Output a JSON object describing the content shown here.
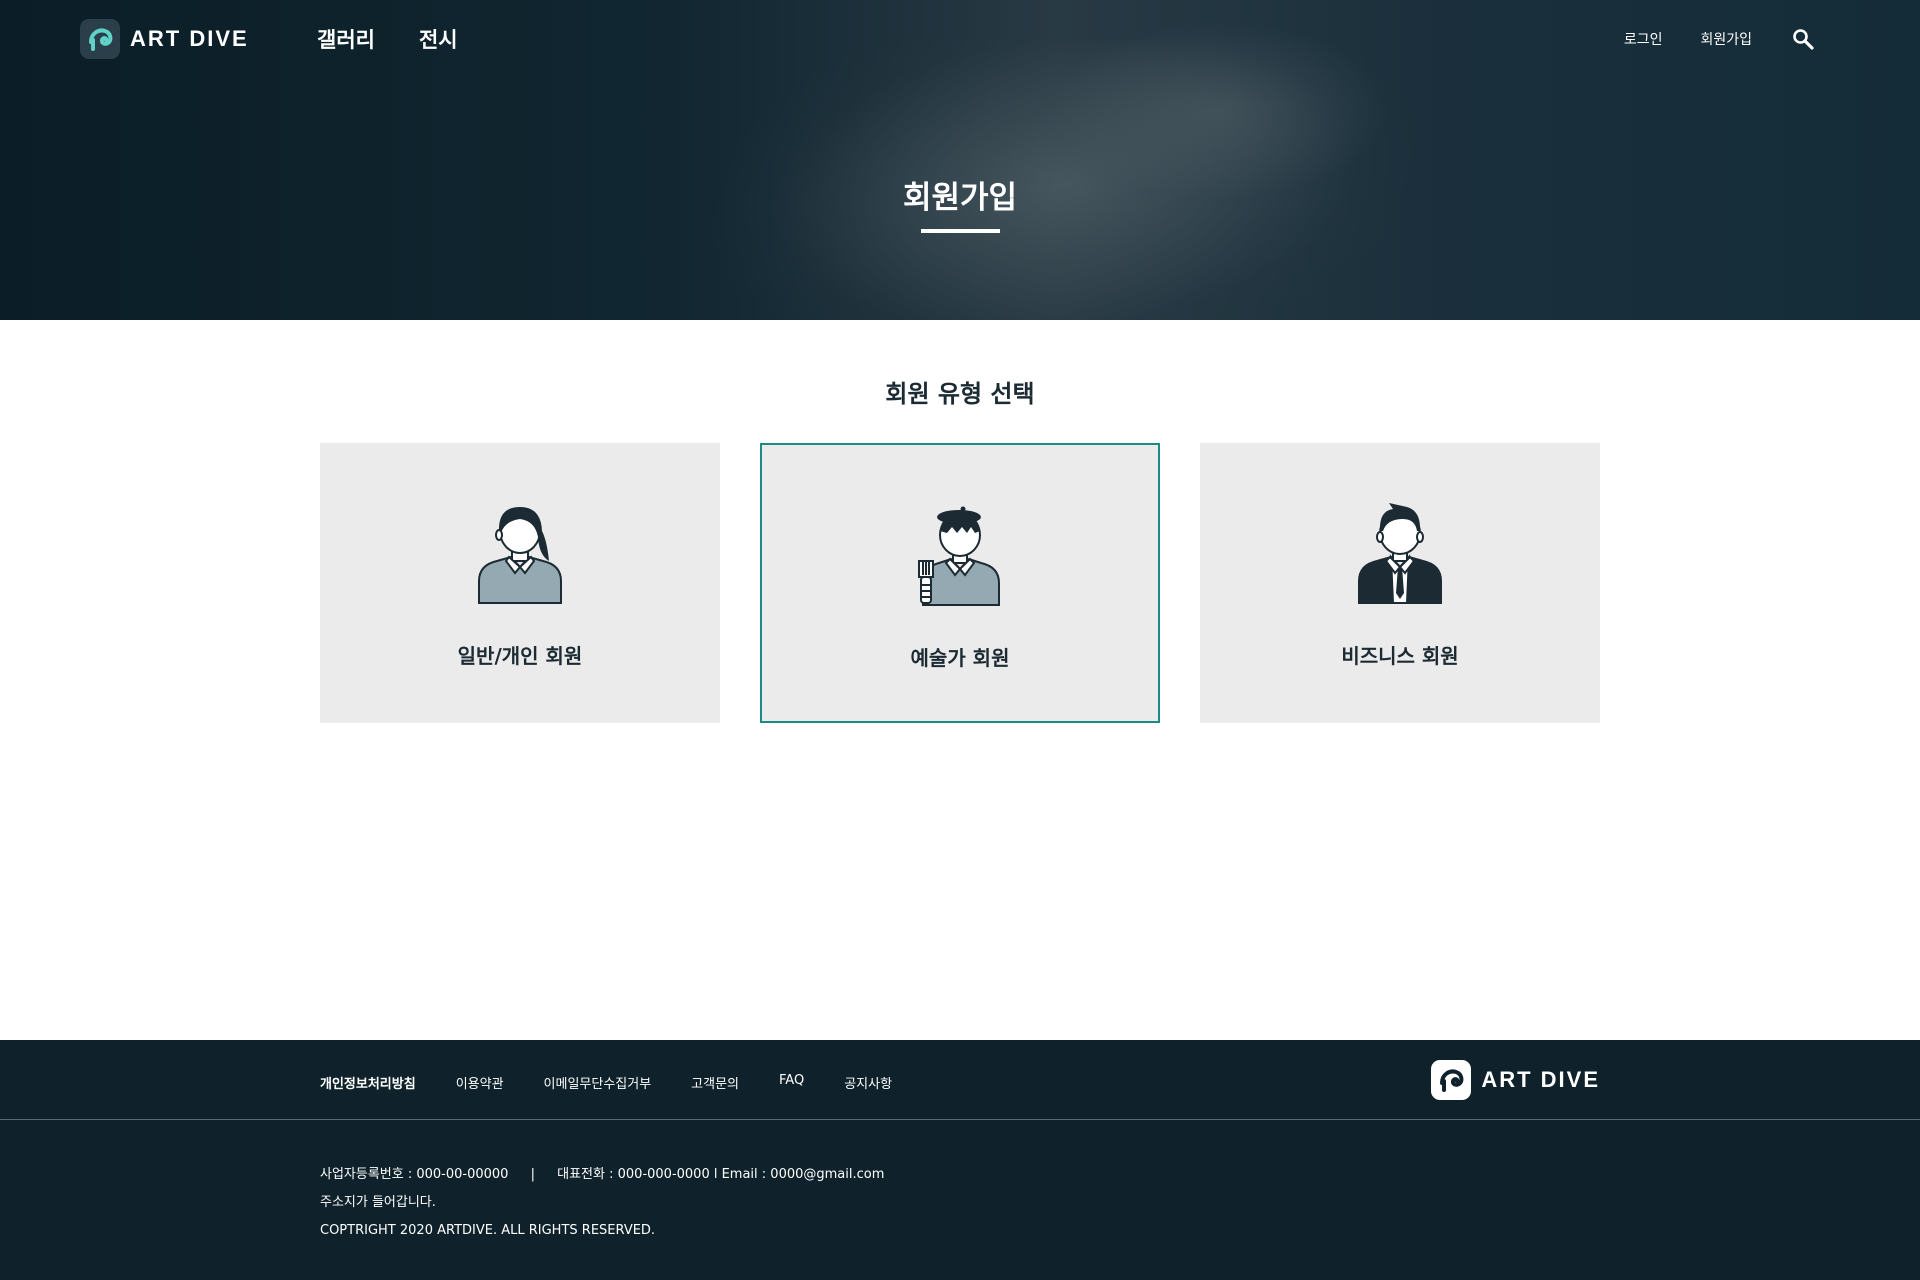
{
  "brand": {
    "name": "ART DIVE"
  },
  "header": {
    "nav": [
      "갤러리",
      "전시"
    ],
    "util": {
      "login": "로그인",
      "signup": "회원가입"
    }
  },
  "hero": {
    "title": "회원가입"
  },
  "main": {
    "section_title": "회원 유형 선택",
    "cards": [
      {
        "label": "일반/개인 회원",
        "selected": false
      },
      {
        "label": "예술가 회원",
        "selected": true
      },
      {
        "label": "비즈니스 회원",
        "selected": false
      }
    ]
  },
  "footer": {
    "links": [
      "개인정보처리방침",
      "이용약관",
      "이메일무단수집거부",
      "고객문의",
      "FAQ",
      "공지사항"
    ],
    "business_number": "사업자등록번호 : 000-00-00000",
    "separator": "|",
    "phone_email": "대표전화 : 000-000-0000  l Email : 0000@gmail.com",
    "address": "주소지가 들어갑니다.",
    "copyright": "COPTRIGHT 2020 ARTDIVE. ALL RIGHTS RESERVED."
  },
  "colors": {
    "accent": "#1e8a86",
    "dark": "#0f222b",
    "card_bg": "#ebebeb",
    "brand_teal": "#5fd3c8"
  },
  "icons": {
    "search": "search-icon",
    "general_member": "woman-avatar-icon",
    "artist_member": "artist-avatar-icon",
    "business_member": "businessman-avatar-icon"
  }
}
